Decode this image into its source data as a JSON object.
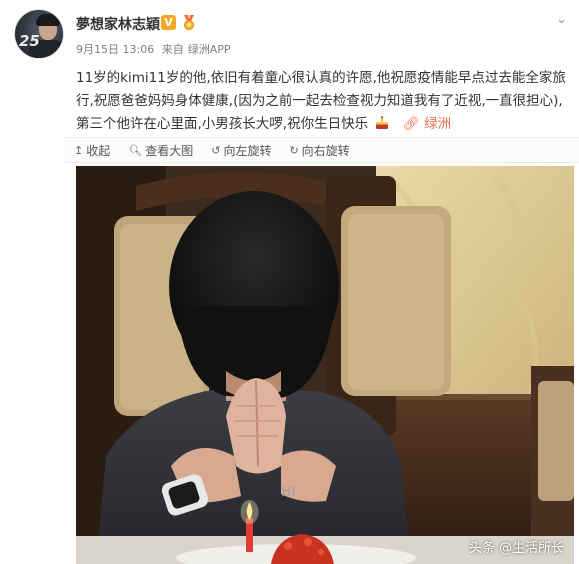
{
  "post": {
    "author_name": "夢想家林志穎",
    "verified_badge": "V",
    "date": "9月15日 13:06",
    "source_prefix": "来自",
    "source": "绿洲APP",
    "body_text": "11岁的kimi11岁的他,依旧有着童心很认真的许愿,他祝愿疫情能早点过去能全家旅行,祝愿爸爸妈妈身体健康,(因为之前一起去检查视力知道我有了近视,一直很担心),第三个他许在心里面,小男孩长大啰,祝你生日快乐",
    "cake_icon": "cake-emoji-icon",
    "location_label": "绿洲"
  },
  "toolbar": {
    "collapse_label": "收起",
    "view_large_label": "查看大图",
    "rotate_left_label": "向左旋转",
    "rotate_right_label": "向右旋转"
  },
  "watermark": {
    "text": "头条 @生活所长"
  },
  "colors": {
    "link_orange": "#eb7350",
    "badge_gold": "#f5a623",
    "meta_gray": "#808080"
  }
}
